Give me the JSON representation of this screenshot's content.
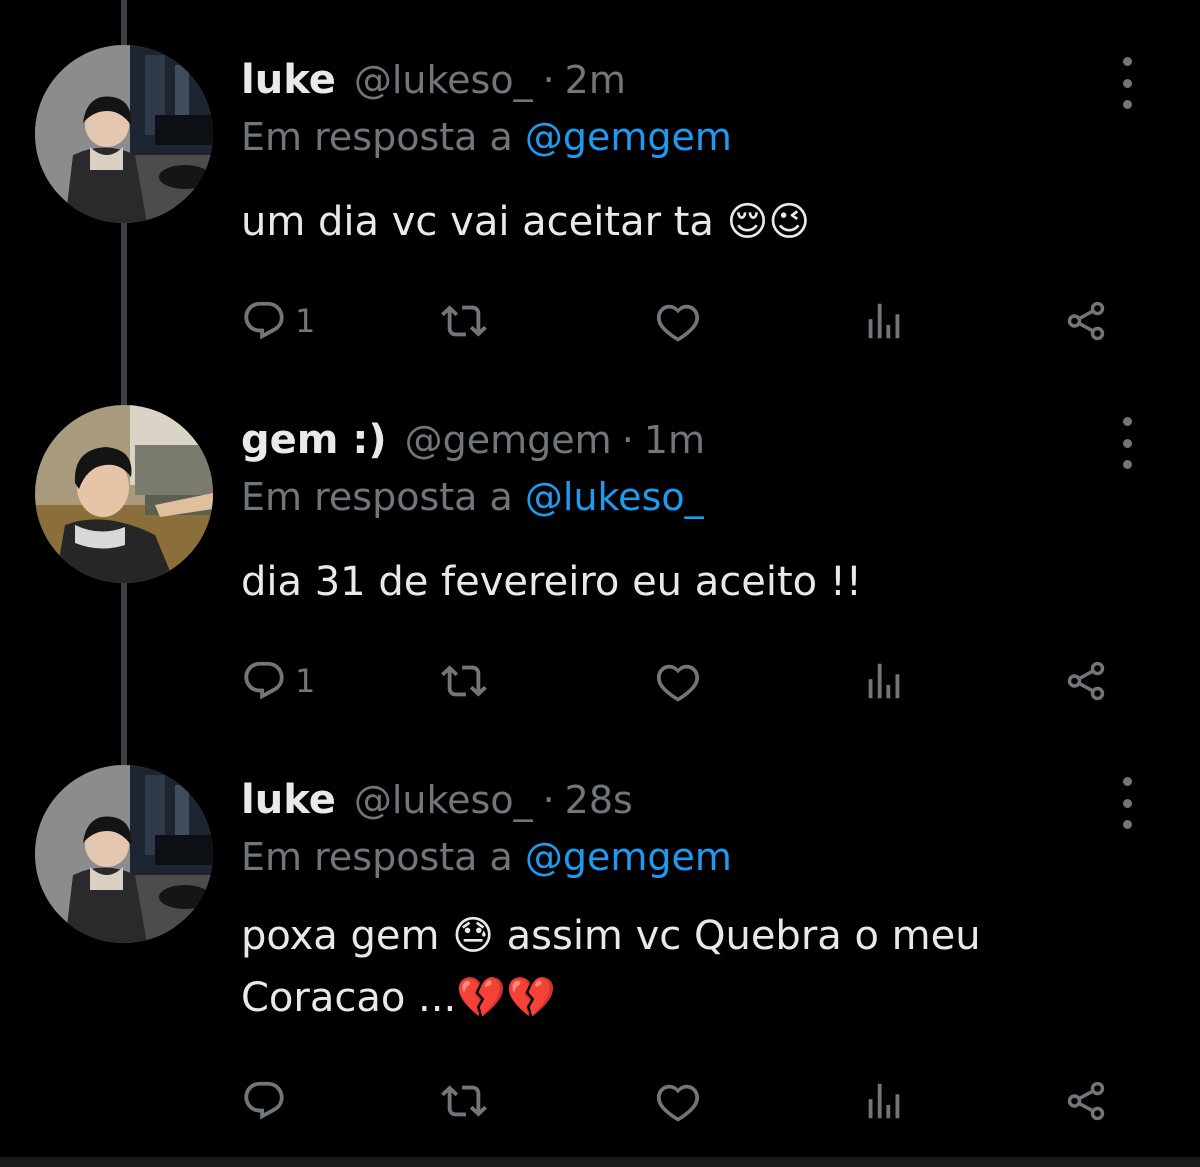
{
  "tweets": [
    {
      "name": "luke",
      "handle": "@lukeso_",
      "separator": "·",
      "time": "2m",
      "reply_prefix": "Em resposta a",
      "reply_mention": "@gemgem",
      "text": "um dia vc vai aceitar ta 😌😉",
      "reply_count": "1",
      "avatar": "luke-avatar"
    },
    {
      "name": "gem :)",
      "handle": "@gemgem",
      "separator": "·",
      "time": "1m",
      "reply_prefix": "Em resposta a",
      "reply_mention": "@lukeso_",
      "text": "dia 31 de fevereiro eu aceito !!",
      "reply_count": "1",
      "avatar": "gem-avatar"
    },
    {
      "name": "luke",
      "handle": "@lukeso_",
      "separator": "·",
      "time": "28s",
      "reply_prefix": "Em resposta a",
      "reply_mention": "@gemgem",
      "text": "poxa gem 😓 assim vc Quebra o meu Coracao ...💔💔",
      "reply_count": "",
      "avatar": "luke-avatar"
    }
  ],
  "icons": [
    "reply-icon",
    "retweet-icon",
    "like-icon",
    "views-icon",
    "share-icon",
    "more-icon"
  ],
  "colors": {
    "background": "#000000",
    "text": "#e7e9ea",
    "secondary": "#71767b",
    "mention": "#1d9bf0",
    "thread_line": "#3a3f44"
  }
}
